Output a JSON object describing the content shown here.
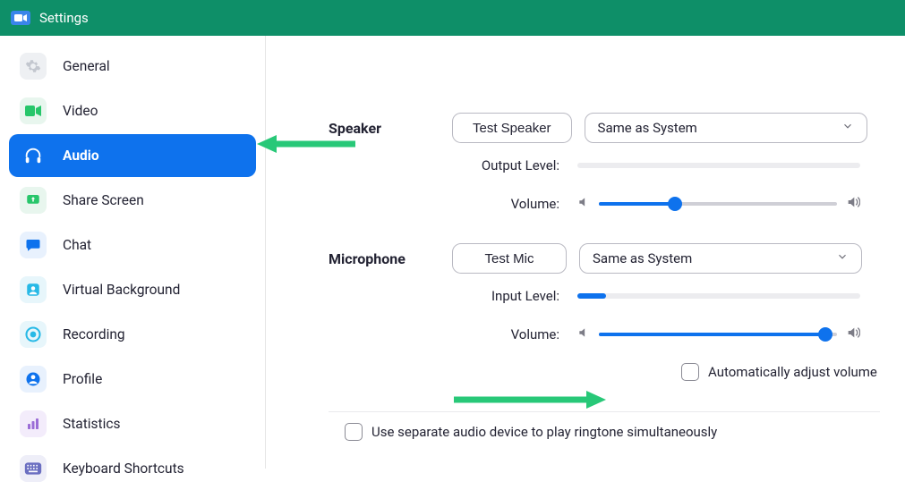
{
  "titlebar": {
    "title": "Settings"
  },
  "sidebar": {
    "items": [
      {
        "label": "General"
      },
      {
        "label": "Video"
      },
      {
        "label": "Audio"
      },
      {
        "label": "Share Screen"
      },
      {
        "label": "Chat"
      },
      {
        "label": "Virtual Background"
      },
      {
        "label": "Recording"
      },
      {
        "label": "Profile"
      },
      {
        "label": "Statistics"
      },
      {
        "label": "Keyboard Shortcuts"
      }
    ]
  },
  "audio": {
    "speaker": {
      "section_label": "Speaker",
      "test_button": "Test Speaker",
      "device": "Same as System",
      "output_level_label": "Output Level:",
      "output_level_percent": 0,
      "volume_label": "Volume:",
      "volume_percent": 32
    },
    "microphone": {
      "section_label": "Microphone",
      "test_button": "Test Mic",
      "device": "Same as System",
      "input_level_label": "Input Level:",
      "input_level_percent": 10,
      "volume_label": "Volume:",
      "volume_percent": 95,
      "auto_adjust_label": "Automatically adjust volume",
      "auto_adjust_checked": false
    },
    "separate_ringtone_label": "Use separate audio device to play ringtone simultaneously",
    "separate_ringtone_checked": false
  }
}
